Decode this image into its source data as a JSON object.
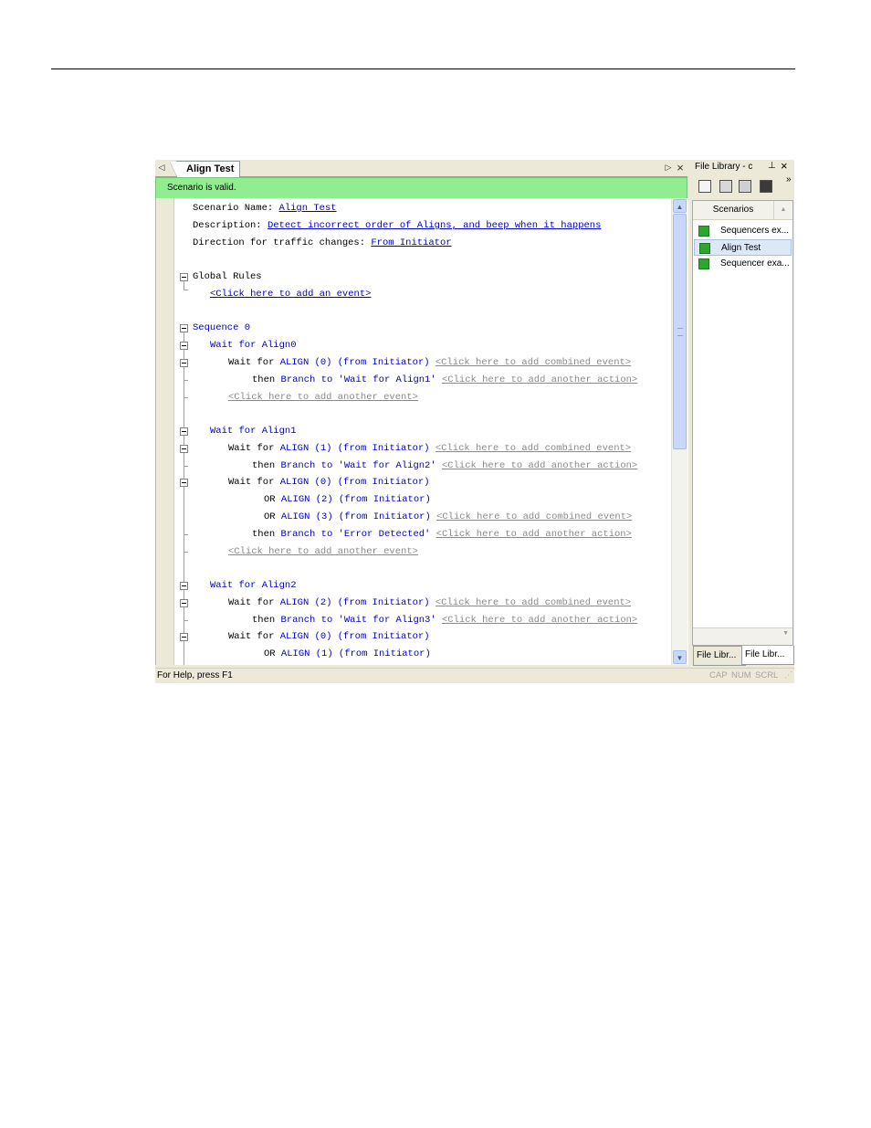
{
  "document_tab": {
    "title": "Align Test",
    "prev_icon": "left-triangle-icon",
    "next_icon": "right-triangle-icon",
    "close": "×"
  },
  "status_banner": "Scenario is valid.",
  "scenario": {
    "name_label": "Scenario Name:",
    "name_value": "Align Test",
    "desc_label": "Description:",
    "desc_value": "Detect incorrect order of Aligns, and beep when it happens",
    "dir_label": "Direction for traffic changes:",
    "dir_value": "From Initiator"
  },
  "global_rules": {
    "label": "Global Rules",
    "add_event": "<Click here to add an event>"
  },
  "sequence": {
    "label": "Sequence 0"
  },
  "states": [
    {
      "label": "Wait for Align0"
    },
    {
      "label": "Wait for Align1"
    },
    {
      "label": "Wait for Align2"
    }
  ],
  "words": {
    "wait_for": "Wait for",
    "then": "then",
    "or": "OR"
  },
  "events": {
    "e0_0": "ALIGN (0) (from Initiator)",
    "e1_1": "ALIGN (1) (from Initiator)",
    "e1_0": "ALIGN (0) (from Initiator)",
    "e1_2": "ALIGN (2) (from Initiator)",
    "e1_3": "ALIGN (3) (from Initiator)",
    "e2_2": "ALIGN (2) (from Initiator)",
    "e2_0": "ALIGN (0) (from Initiator)",
    "e2_1": "ALIGN (1) (from Initiator)"
  },
  "actions": {
    "a0": "Branch to 'Wait for Align1'",
    "a1": "Branch to 'Wait for Align2'",
    "a1err": "Branch to 'Error Detected'",
    "a2": "Branch to 'Wait for Align3'"
  },
  "placeholders": {
    "combined_event": "<Click here to add combined event>",
    "another_action": "<Click here to add another action>",
    "another_event": "<Click here to add another event>"
  },
  "side_panel": {
    "title": "File Library - c",
    "pin": "⊥",
    "close": "×",
    "overflow": "»",
    "column_header": "Scenarios",
    "items": [
      {
        "label": "Sequencers ex..."
      },
      {
        "label": "Align Test",
        "selected": true
      },
      {
        "label": "Sequencer exa..."
      }
    ],
    "tabs": [
      {
        "label": "File Libr..."
      },
      {
        "label": "File Libr...",
        "active": true
      }
    ]
  },
  "statusbar": {
    "help": "For Help, press F1",
    "cap": "CAP",
    "num": "NUM",
    "scrl": "SCRL"
  },
  "colors": {
    "valid_banner": "#90ee90",
    "keyword_blue": "#0000cc",
    "placeholder_gray": "#8a8a8a"
  }
}
